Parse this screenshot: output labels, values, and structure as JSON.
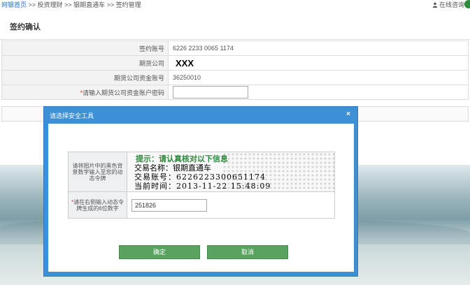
{
  "breadcrumb": {
    "home": "网银首页",
    "sep1": " >> ",
    "item1": "投资理财",
    "sep2": " >> ",
    "item2": "银期直通车",
    "sep3": " >> ",
    "item3": "签约管理"
  },
  "header": {
    "online_consult": "在线咨询"
  },
  "page": {
    "title": "签约确认"
  },
  "form": {
    "rows": [
      {
        "label": "签约账号",
        "value": "6226 2233 0065 1174"
      },
      {
        "label": "期货公司",
        "value": "XXX"
      },
      {
        "label": "期货公司资金账号",
        "value": "36250010"
      }
    ],
    "password_required_mark": "*",
    "password_label": "请输入期货公司资金账户密码",
    "password_value": ""
  },
  "dialog": {
    "title": "请选择安全工具",
    "close": "×",
    "token_label": "请将图片中的黑色背景数字输入至您的动态令牌",
    "token_image": {
      "hint": "提示：请认真核对以下信息",
      "trade_name": "交易名称：银期直通车",
      "account": "交易账号：6226223300651174",
      "time": "当前时间：2013-11-22 15:48:09"
    },
    "code_required_mark": "*",
    "code_label": "请在右侧输入动态令牌生成的6位数字",
    "code_value": "251826",
    "ok_label": "确定",
    "cancel_label": "取消"
  },
  "colors": {
    "dialog_blue": "#3d8fd6",
    "button_green": "#57a35f",
    "hint_green": "#2c8a3c",
    "link_blue": "#1a6ec9"
  }
}
